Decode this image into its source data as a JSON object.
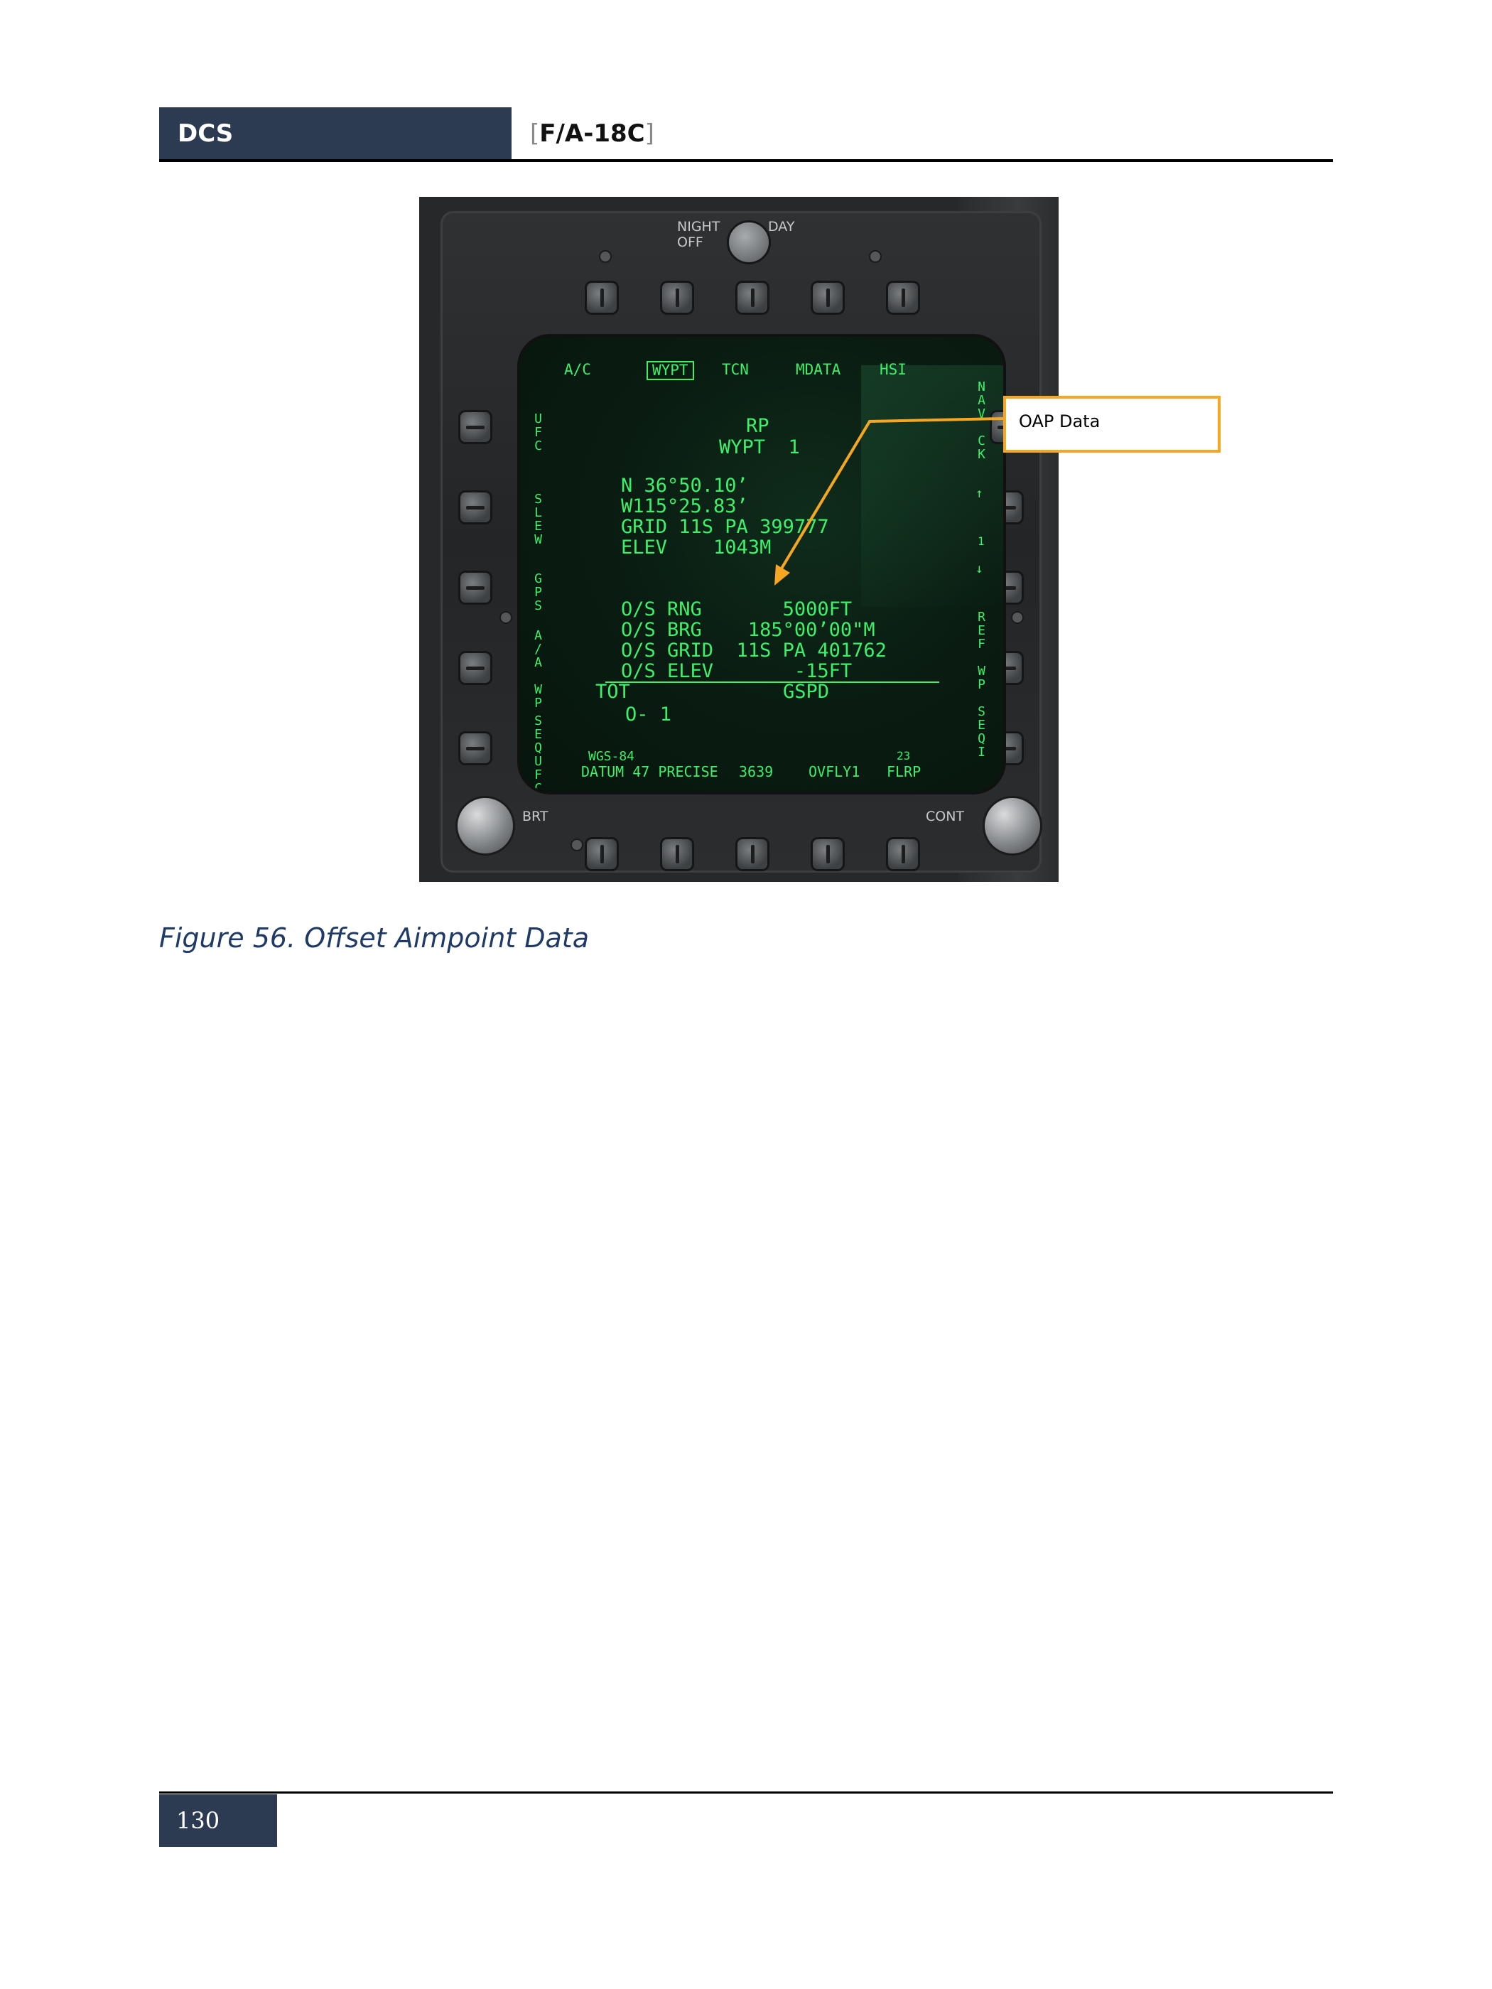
{
  "header": {
    "left": "DCS",
    "title": "F/A-18C",
    "bracket_open": "[",
    "bracket_close": "]"
  },
  "mfd": {
    "switch_labels": {
      "night": "NIGHT",
      "off": "OFF",
      "day": "DAY"
    },
    "top_tabs": [
      "A/C",
      "WYPT",
      "TCN",
      "MDATA",
      "HSI"
    ],
    "selected_tab": "WYPT",
    "left_side": [
      "UFC",
      "SLEW",
      "GPS",
      "A/A WP",
      "SEQUFC"
    ],
    "right_side": [
      "NAV CK",
      "1",
      "REF",
      "WP SEQI"
    ],
    "center": {
      "rp": "RP",
      "wypt": "WYPT  1",
      "lat": "N 36°50.10’",
      "lon": "W115°25.83’",
      "grid": "GRID 11S PA 399777",
      "elev": "ELEV    1043M",
      "os_rng": "O/S RNG       5000FT",
      "os_brg": "O/S BRG    185°00’00\"M",
      "os_grid": "O/S GRID  11S PA 401762",
      "os_elev": "O/S ELEV       -15FT",
      "tot": "TOT",
      "gspd": "GSPD",
      "tot_value": "O- 1"
    },
    "bottom": {
      "wgs": "WGS-84",
      "datum": "DATUM 47 PRECISE",
      "num": "3639",
      "ovfly": "OVFLY1",
      "flrp_num": "23",
      "flrp": "FLRP"
    },
    "knob_labels": {
      "brt": "BRT",
      "cont": "CONT"
    }
  },
  "callout": {
    "label": "OAP Data",
    "color": "#f5a623"
  },
  "caption": "Figure 56. Offset Aimpoint Data",
  "footer": {
    "page": "130"
  },
  "colors": {
    "header_bg": "#2c3a52",
    "screen_text": "#3df06a"
  }
}
